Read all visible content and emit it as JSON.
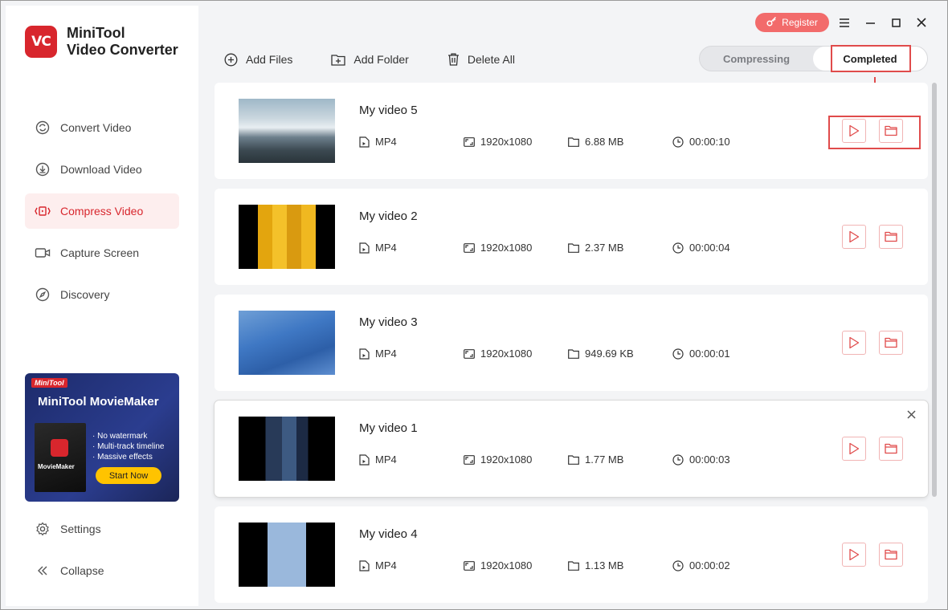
{
  "app": {
    "logo_text": "VC",
    "title_line1": "MiniTool",
    "title_line2": "Video Converter"
  },
  "sidebar": {
    "items": [
      {
        "label": "Convert Video",
        "icon": "convert-icon"
      },
      {
        "label": "Download Video",
        "icon": "download-icon"
      },
      {
        "label": "Compress Video",
        "icon": "compress-icon",
        "active": true
      },
      {
        "label": "Capture Screen",
        "icon": "camera-icon"
      },
      {
        "label": "Discovery",
        "icon": "compass-icon"
      }
    ],
    "promo": {
      "badge": "MiniTool",
      "title": "MiniTool MovieMaker",
      "box_label": "MovieMaker",
      "features": [
        "· No watermark",
        "· Multi-track timeline",
        "· Massive effects"
      ],
      "button": "Start Now"
    },
    "bottom": [
      {
        "label": "Settings",
        "icon": "gear-icon"
      },
      {
        "label": "Collapse",
        "icon": "collapse-icon"
      }
    ]
  },
  "titlebar": {
    "register_label": "Register"
  },
  "toolbar": {
    "add_files": "Add Files",
    "add_folder": "Add Folder",
    "delete_all": "Delete All"
  },
  "tabs": {
    "compressing": "Compressing",
    "completed": "Completed",
    "active": "completed"
  },
  "videos": [
    {
      "title": "My video 5",
      "format": "MP4",
      "resolution": "1920x1080",
      "size": "6.88 MB",
      "duration": "00:00:10"
    },
    {
      "title": "My video 2",
      "format": "MP4",
      "resolution": "1920x1080",
      "size": "2.37 MB",
      "duration": "00:00:04"
    },
    {
      "title": "My video 3",
      "format": "MP4",
      "resolution": "1920x1080",
      "size": "949.69 KB",
      "duration": "00:00:01"
    },
    {
      "title": "My video 1",
      "format": "MP4",
      "resolution": "1920x1080",
      "size": "1.77 MB",
      "duration": "00:00:03"
    },
    {
      "title": "My video 4",
      "format": "MP4",
      "resolution": "1920x1080",
      "size": "1.13 MB",
      "duration": "00:00:02"
    }
  ],
  "colors": {
    "accent": "#d8262d",
    "register": "#f26b6b",
    "annotation": "#e04b4b"
  }
}
